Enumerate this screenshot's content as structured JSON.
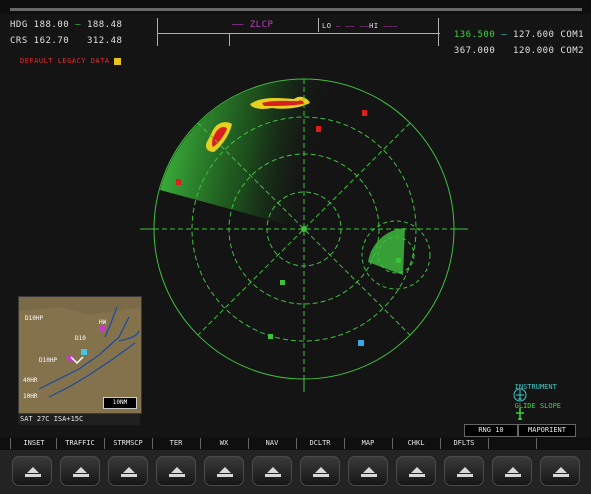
{
  "header": {
    "hdg_selected": "HDG 188.00",
    "hdg_selected_value": "188.48",
    "crs_row": "CRS 162.70",
    "crs_value": "312.48",
    "active_label": "ZLCP",
    "com_active_1": "136.500",
    "com_standby_1": "127.600",
    "com1_label": "COM1",
    "com_active_2": "367.000",
    "com_standby_2": "120.000",
    "com2_label": "COM2",
    "mid_scale_1": "LO",
    "mid_scale_2": "HI"
  },
  "weather_advisory": "DEFAULT LEGACY DATA",
  "legend": {
    "item1": "INSTRUMENT",
    "item2": "GLIDE SLOPE"
  },
  "inset_map": {
    "labels": [
      "D10HP",
      "HW",
      "D10",
      "D10HP",
      "40HR",
      "10HR"
    ],
    "scale": "10NM",
    "status": "SAT 27C ISA+15C"
  },
  "range_boxes": {
    "left": "RNG 10",
    "right": "MAPORIENT"
  },
  "softkeys": [
    "INSET",
    "TRAFFIC",
    "STRMSCP",
    "TER",
    "WX",
    "NAV",
    "DCLTR",
    "MAP",
    "CHKL",
    "DFLTS",
    "",
    ""
  ],
  "colors": {
    "radar_green": "#2f8a2f",
    "weather_red": "#d82020",
    "weather_yellow": "#e8d020",
    "traffic_cyan": "#38a8e8"
  }
}
